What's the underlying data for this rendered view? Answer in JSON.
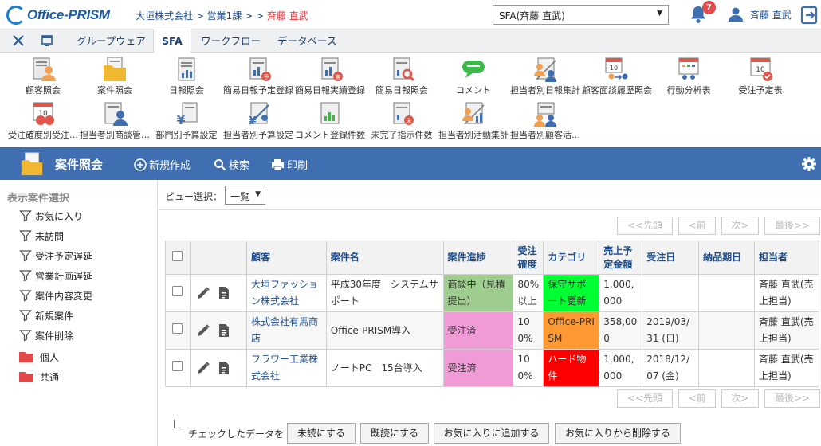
{
  "header": {
    "logo": "Office-PRISM",
    "breadcrumb_pre": "大垣株式会社 > 営業1課 > > ",
    "breadcrumb_current": "斉藤 直武",
    "sfa_select": "SFA(斉藤 直武)",
    "notification_count": "7",
    "user_name": "斉藤 直武"
  },
  "tabs": [
    "グループウェア",
    "SFA",
    "ワークフロー",
    "データベース"
  ],
  "menu": {
    "row1": [
      "顧客照会",
      "案件照会",
      "日報照会",
      "簡易日報予定登録",
      "簡易日報実績登録",
      "簡易日報照会",
      "コメント",
      "担当者別日報集計",
      "顧客面談履歴照会",
      "行動分析表",
      "受注予定表"
    ],
    "row2": [
      "受注確度別受注…",
      "担当者別商談管…",
      "部門別予算設定",
      "担当者別予算設定",
      "コメント登録件数",
      "未完了指示件数",
      "担当者別活動集計",
      "担当者別顧客活…"
    ]
  },
  "toolbar": {
    "title": "案件照会",
    "new_label": "新規作成",
    "search_label": "検索",
    "print_label": "印刷"
  },
  "sidebar": {
    "title": "表示案件選択",
    "filters": [
      "お気に入り",
      "未訪問",
      "受注予定遅延",
      "営業計画遅延",
      "案件内容変更",
      "新規案件",
      "案件削除"
    ],
    "folders": [
      "個人",
      "共通"
    ]
  },
  "view": {
    "label": "ビュー選択：",
    "selected": "一覧"
  },
  "pager": {
    "first": "<<先頭",
    "prev": "<前",
    "next": "次>",
    "last": "最後>>"
  },
  "table": {
    "headers": [
      "顧客",
      "案件名",
      "案件進捗",
      "受注確度",
      "カテゴリ",
      "売上予定金額",
      "受注日",
      "納品期日",
      "担当者"
    ],
    "rows": [
      {
        "customer": "大垣ファッション株式会社",
        "project": "平成30年度　システムサポート",
        "progress": "商談中（見積提出）",
        "progress_color": "#9fcd8f",
        "probability": "80%以上",
        "category": "保守サポート更新",
        "category_color": "#00ff33",
        "amount": "1,000,000",
        "order_date": "",
        "delivery": "",
        "owner": "斉藤 直武(売上担当)"
      },
      {
        "customer": "株式会社有馬商店",
        "project": "Office-PRISM導入",
        "progress": "受注済",
        "progress_color": "#f09ad6",
        "probability": "100%",
        "category": "Office-PRISM",
        "category_color": "#ff9933",
        "amount": "358,000",
        "order_date": "2019/03/31 (日)",
        "delivery": "",
        "owner": "斉藤 直武(売上担当)"
      },
      {
        "customer": "フラワー工業株式会社",
        "project": "ノートPC　15台導入",
        "progress": "受注済",
        "progress_color": "#f09ad6",
        "probability": "100%",
        "category": "ハード物件",
        "category_color": "#ff0000",
        "amount": "1,000,000",
        "order_date": "2018/12/07 (金)",
        "delivery": "",
        "owner": "斉藤 直武(売上担当)"
      }
    ]
  },
  "bulk": {
    "label": "チェックしたデータを",
    "unread": "未読にする",
    "read": "既読にする",
    "fav_add": "お気に入りに追加する",
    "fav_remove": "お気に入りから削除する"
  },
  "colors": {
    "accent": "#3f6fb1",
    "link": "#1f4e8c",
    "badge": "#e24a4a"
  }
}
